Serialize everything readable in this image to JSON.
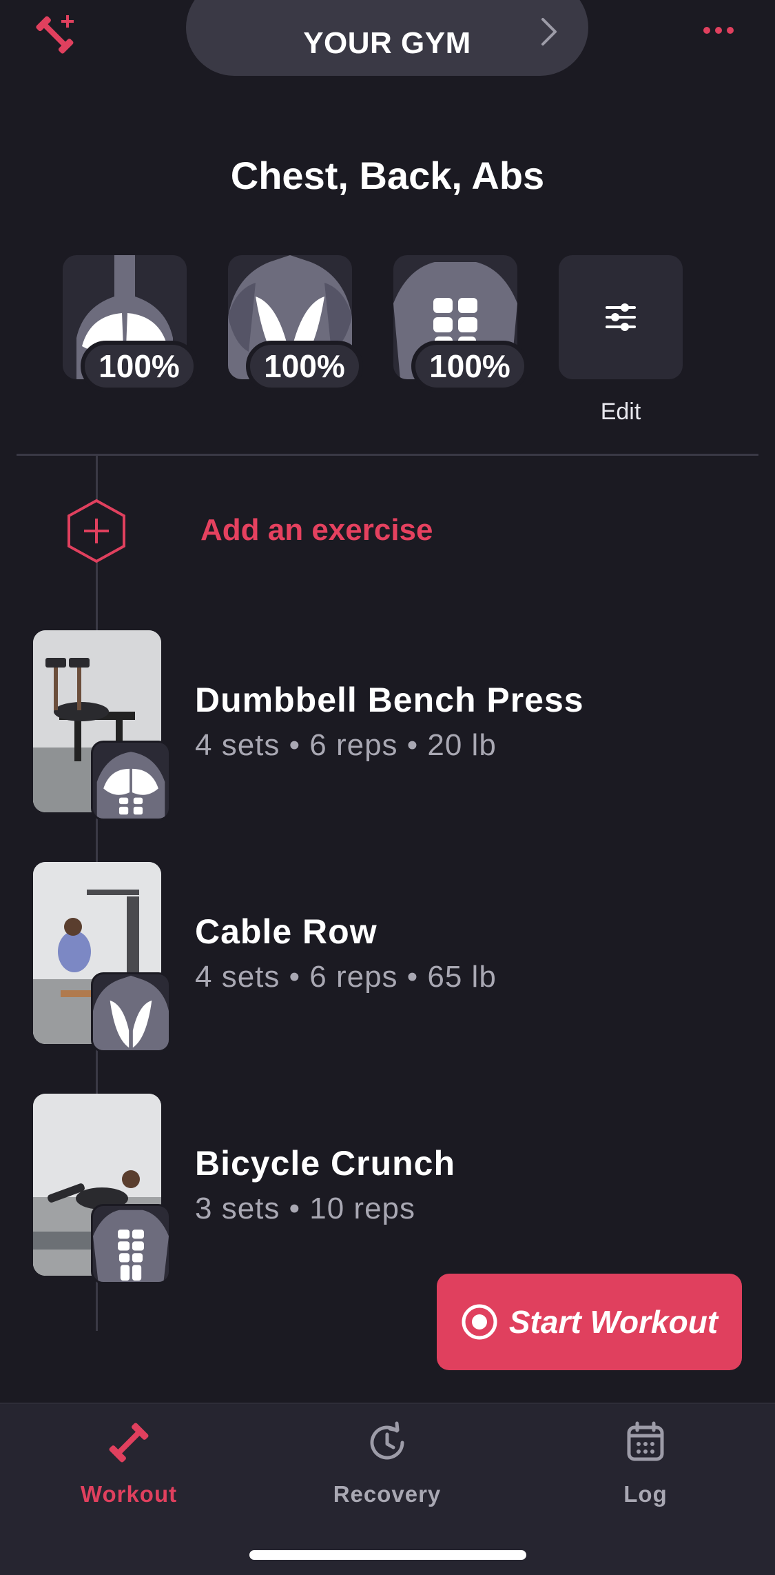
{
  "header": {
    "gym_label": "YOUR GYM",
    "workout_title": "Chest, Back, Abs"
  },
  "muscles": [
    {
      "name": "chest",
      "percent": "100%"
    },
    {
      "name": "back",
      "percent": "100%"
    },
    {
      "name": "abs",
      "percent": "100%"
    }
  ],
  "edit_label": "Edit",
  "add_exercise_label": "Add an exercise",
  "exercises": [
    {
      "name": "Dumbbell Bench Press",
      "meta": "4 sets • 6 reps • 20 lb",
      "muscle": "chest"
    },
    {
      "name": "Cable Row",
      "meta": "4 sets • 6 reps • 65 lb",
      "muscle": "back"
    },
    {
      "name": "Bicycle Crunch",
      "meta": "3 sets • 10 reps",
      "muscle": "abs"
    }
  ],
  "start_button_label": "Start Workout",
  "tabs": [
    {
      "label": "Workout",
      "icon": "dumbbell-icon",
      "active": true
    },
    {
      "label": "Recovery",
      "icon": "recovery-icon",
      "active": false
    },
    {
      "label": "Log",
      "icon": "calendar-icon",
      "active": false
    }
  ],
  "colors": {
    "accent": "#e0405e",
    "background": "#1b1a22",
    "tile": "#2b2a35",
    "muted_text": "#a9a8b3"
  }
}
